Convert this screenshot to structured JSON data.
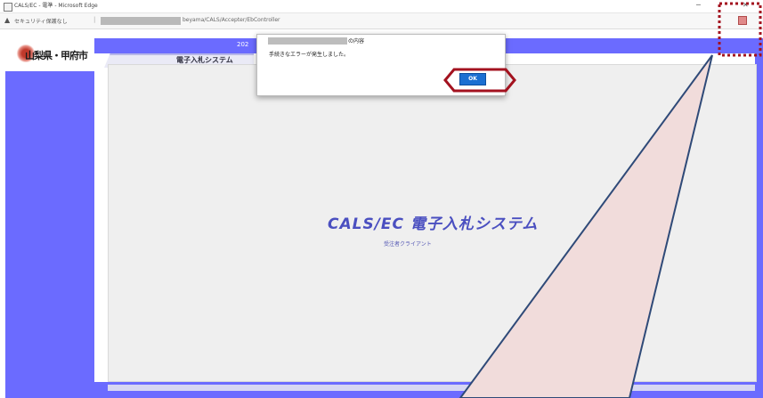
{
  "window": {
    "title": "CALS/EC - 電準 - Microsoft Edge",
    "minimize": "─",
    "close": "✕"
  },
  "address_bar": {
    "security_label": "セキュリティ保護なし",
    "separator": "|",
    "url_visible": "beyama/CALS/Accepter/EbController"
  },
  "page": {
    "logo_text": "山梨県・甲府市",
    "date_fragment": "202",
    "system_tab": "電子入札システム",
    "center_title": "CALS/EC 電子入札システム",
    "center_subtitle": "受注者クライアント"
  },
  "dialog": {
    "title_suffix": "の内容",
    "message": "手続きなエラーが発生しました。",
    "ok_label": "OK"
  },
  "colors": {
    "page_blue": "#6b6bff",
    "highlight_red": "#a3121f",
    "callout_fill": "#f1dcdb",
    "callout_stroke": "#2f4a78",
    "ok_button": "#1b6fd1"
  }
}
